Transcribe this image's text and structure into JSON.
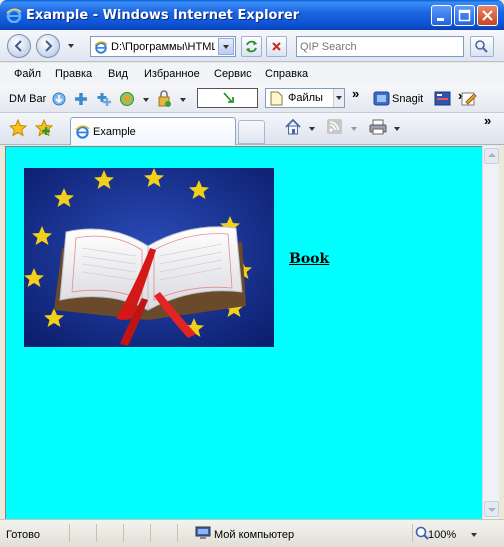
{
  "window": {
    "title": "Example - Windows Internet Explorer",
    "controls": [
      "minimize",
      "maximize",
      "close"
    ]
  },
  "address_bar": {
    "url": "D:\\Программы\\HTML\\",
    "search_placeholder": "QIP Search"
  },
  "menu": {
    "items": [
      {
        "label": "Файл"
      },
      {
        "label": "Правка"
      },
      {
        "label": "Вид"
      },
      {
        "label": "Избранное"
      },
      {
        "label": "Сервис"
      },
      {
        "label": "Справка"
      }
    ]
  },
  "links_bar": {
    "dm_bar_label": "DM Bar",
    "files_label": "Файлы",
    "snagit_label": "Snagit",
    "overflow": "»"
  },
  "tabs": {
    "active_label": "Example"
  },
  "page": {
    "background_color": "#00ffff",
    "image_alt": "Book",
    "link_text": "Book"
  },
  "status_bar": {
    "status": "Готово",
    "zone": "Мой компьютер",
    "zoom": "100%"
  }
}
